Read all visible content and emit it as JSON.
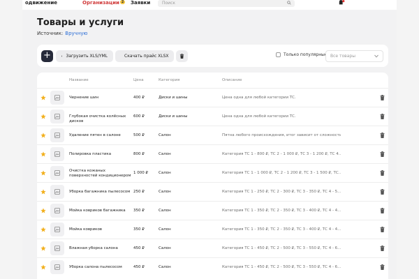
{
  "nav": {
    "item1": "одвижение",
    "item2": "Организации",
    "item2_badge": "2",
    "item3": "Заявки"
  },
  "search": {
    "placeholder": "Поиск"
  },
  "page": {
    "title": "Товары и услуги",
    "source_label": "Источник:",
    "source_value": "Вручную"
  },
  "toolbar": {
    "add_label": "+",
    "upload_label": "Загрузить XLS/YML",
    "download_label": "Скачать прайс XLSX",
    "popular_label": "Только популярные",
    "filter_value": "Все товары"
  },
  "table": {
    "headers": {
      "name": "Название",
      "price": "Цена",
      "category": "Категория",
      "description": "Описание"
    },
    "rows": [
      {
        "name": "Чернение шин",
        "price": "400 ₽",
        "category": "Диски и шины",
        "description": "Цена одна для любой категории ТС."
      },
      {
        "name": "Глубокая очистка колёсных дисков",
        "price": "600 ₽",
        "category": "Диски и шины",
        "description": "Цена одна для любой категории ТС."
      },
      {
        "name": "Удаление пятен в салоне",
        "price": "500 ₽",
        "category": "Салон",
        "description": "Пятна любого происхождения, итог зависит от сложности. Цена ..."
      },
      {
        "name": "Полировка пластика",
        "price": "800 ₽",
        "category": "Салон",
        "description": "Категория ТС 1 - 800 ₽, ТС 2 - 1 000 ₽, ТС 3 - 1 200 ₽, ТС 4..."
      },
      {
        "name": "Очистка кожаных поверхностей кондиционером",
        "price": "1 000 ₽",
        "category": "Салон",
        "description": "Категория ТС 1 - 1 000 ₽, ТС 2 - 1 200 ₽, ТС 3 - 1 500 ₽, ТС..."
      },
      {
        "name": "Уборка багажника пылесосом",
        "price": "250 ₽",
        "category": "Салон",
        "description": "Категория ТС 1 - 250 ₽, ТС 2 - 300 ₽, ТС 3 - 350 ₽, ТС 4 - 5..."
      },
      {
        "name": "Мойка ковриков багажника",
        "price": "350 ₽",
        "category": "Салон",
        "description": "Категория ТС 1 - 350 ₽, ТС 2 - 350 ₽, ТС 3 - 400 ₽, ТС 4 - 4..."
      },
      {
        "name": "Мойка ковриков",
        "price": "350 ₽",
        "category": "Салон",
        "description": "Категория ТС 1 - 350 ₽, ТС 2 - 350 ₽, ТС 3 - 400 ₽, ТС 4 - 4..."
      },
      {
        "name": "Влажная уборка салона",
        "price": "450 ₽",
        "category": "Салон",
        "description": "Категория ТС 1 - 450 ₽, ТС 2 - 500 ₽, ТС 3 - 550 ₽, ТС 4 - 6..."
      },
      {
        "name": "Уборка салона пылесосом",
        "price": "450 ₽",
        "category": "Салон",
        "description": "Категория ТС 1 - 450 ₽, ТС 2 - 500 ₽, ТС 3 - 550 ₽, ТС 4 - 6..."
      }
    ]
  },
  "colors": {
    "accent_dark": "#262a3a",
    "link": "#2d6fd6",
    "star": "#f2b01e",
    "active_nav": "#d03a3a"
  },
  "icons": {
    "star": "star-icon",
    "thumb": "image-placeholder-icon",
    "delete": "trash-icon",
    "search": "search-icon",
    "bell": "bell-icon"
  }
}
